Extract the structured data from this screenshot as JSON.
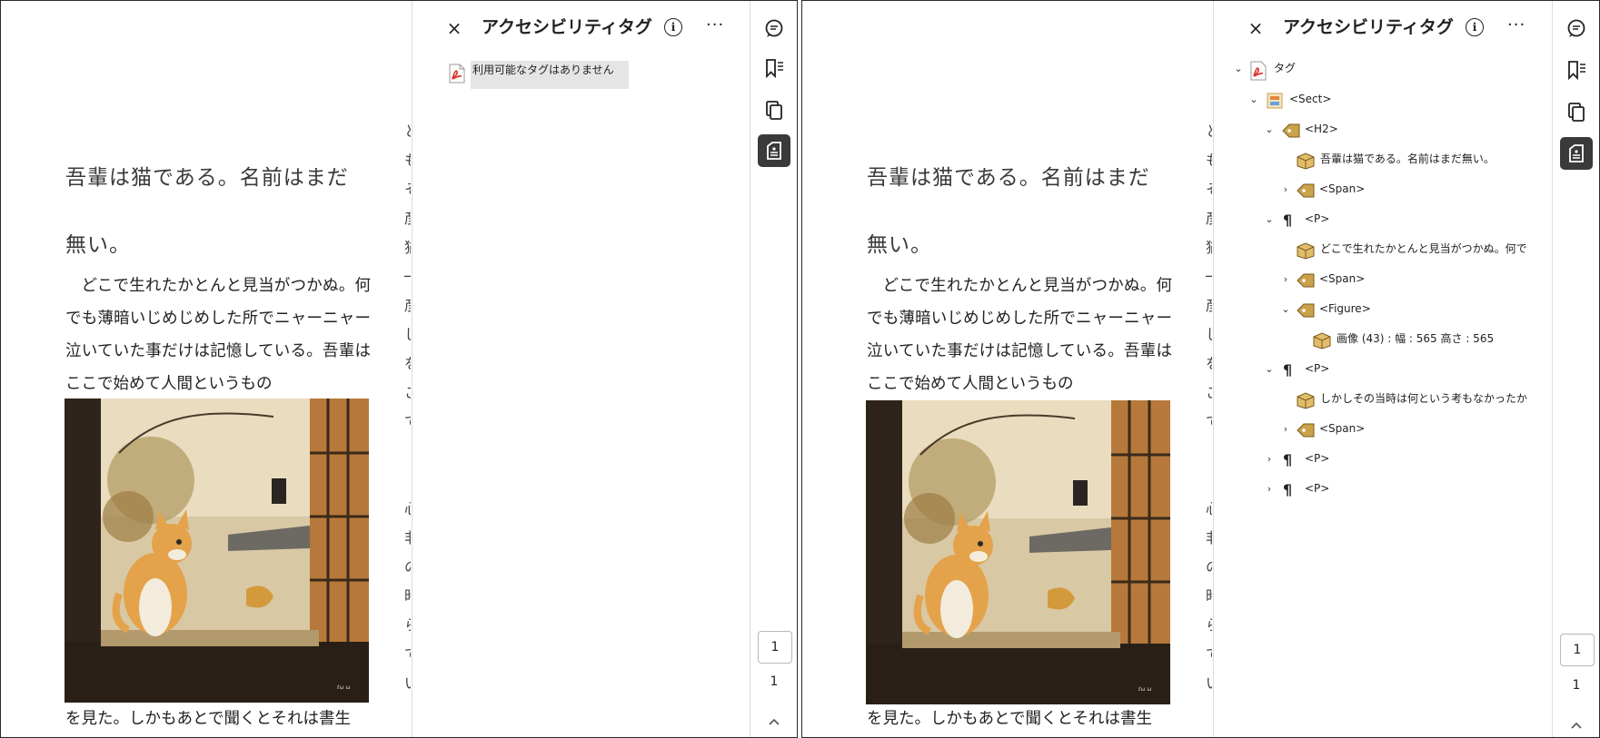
{
  "document": {
    "title_line1": "吾輩は猫である。名前はまだ",
    "title_line2": "無い。",
    "body_text": "どこで生れたかとんと見当がつかぬ。何でも薄暗いじめじめした所でニャーニャー泣いていた事だけは記憶している。吾輩はここで始めて人間というもの",
    "bottom_line": "を見た。しかもあとで聞くとそれは書生",
    "next_column_chars": [
      "と",
      "も",
      "そ",
      "彦",
      "猫",
      "─",
      "彦",
      "し",
      "を",
      "こ",
      "で",
      "",
      "",
      "心",
      "非",
      "の",
      "時",
      "ら",
      "で",
      "い"
    ],
    "figure_alt": "窓辺に座る茶トラ猫の絵"
  },
  "left_panel": {
    "title": "アクセシビリティタグ",
    "close_label": "×",
    "info_label": "i",
    "more_label": "···",
    "no_tags_message": "利用可能なタグはありません",
    "page_current": "1",
    "page_total": "1"
  },
  "right_panel": {
    "title": "アクセシビリティタグ",
    "close_label": "×",
    "info_label": "i",
    "more_label": "···",
    "page_current": "1",
    "page_total": "1",
    "tree": [
      {
        "label": "タグ",
        "icon": "pdf-icon",
        "expanded": true
      },
      {
        "label": "<Sect>",
        "icon": "sect-icon",
        "expanded": true
      },
      {
        "label": "<H2>",
        "icon": "tag-icon",
        "expanded": true
      },
      {
        "label": "吾輩は猫である。名前はまだ無い。",
        "icon": "content-icon"
      },
      {
        "label": "<Span>",
        "icon": "tag-icon",
        "expanded": false
      },
      {
        "label": "<P>",
        "icon": "paragraph-icon",
        "expanded": true
      },
      {
        "label": "どこで生れたかとんと見当がつかぬ。何で",
        "icon": "content-icon"
      },
      {
        "label": "<Span>",
        "icon": "tag-icon",
        "expanded": false
      },
      {
        "label": "<Figure>",
        "icon": "tag-icon",
        "expanded": true
      },
      {
        "label": "画像 (43) : 幅 : 565 高さ : 565",
        "icon": "content-icon"
      },
      {
        "label": "<P>",
        "icon": "paragraph-icon",
        "expanded": true
      },
      {
        "label": "しかしその当時は何という考もなかったか",
        "icon": "content-icon"
      },
      {
        "label": "<Span>",
        "icon": "tag-icon",
        "expanded": false
      },
      {
        "label": "<P>",
        "icon": "paragraph-icon",
        "expanded": false
      },
      {
        "label": "<P>",
        "icon": "paragraph-icon",
        "expanded": false
      }
    ]
  },
  "rail_icons": [
    "comment-icon",
    "bookmark-icon",
    "pages-icon",
    "accessibility-tags-icon"
  ],
  "colors": {
    "active_rail": "#3a3a3a",
    "no_tags_highlight": "#e5e5e5",
    "pdf_red": "#d9342b",
    "tag_gold": "#c9a24a"
  }
}
